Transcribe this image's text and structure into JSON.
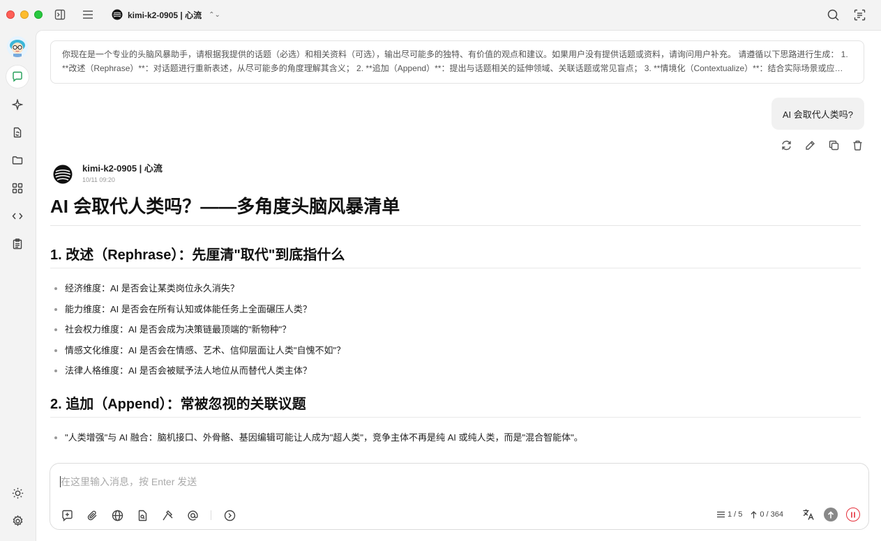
{
  "titlebar": {
    "model_label": "kimi-k2-0905 | 心流"
  },
  "system_prompt": {
    "text": "你现在是一个专业的头脑风暴助手，请根据我提供的话题（必选）和相关资料（可选），输出尽可能多的独特、有价值的观点和建议。如果用户没有提供话题或资料，请询问用户补充。 请遵循以下思路进行生成： 1. **改述（Rephrase）**：对话题进行重新表述，从尽可能多的角度理解其含义； 2. **追加（Append）**：提出与话题相关的延伸领域、关联话题或常见盲点； 3. **情境化（Contextualize）**：结合实际场景或应…"
  },
  "user_message": {
    "text": "AI 会取代人类吗?"
  },
  "assistant": {
    "name": "kimi-k2-0905 | 心流",
    "time": "10/11 09:20",
    "title": "AI 会取代人类吗？——多角度头脑风暴清单",
    "sections": [
      {
        "heading": "1. 改述（Rephrase）：先厘清\"取代\"到底指什么",
        "items": [
          "经济维度：AI 是否会让某类岗位永久消失？",
          "能力维度：AI 是否会在所有认知或体能任务上全面碾压人类？",
          "社会权力维度：AI 是否会成为决策链最顶端的\"新物种\"？",
          "情感文化维度：AI 是否会在情感、艺术、信仰层面让人类\"自愧不如\"？",
          "法律人格维度：AI 是否会被赋予法人地位从而替代人类主体？"
        ]
      },
      {
        "heading": "2. 追加（Append）：常被忽视的关联议题",
        "items": [
          "\"人类增强\"与 AI 融合：脑机接口、外骨骼、基因编辑可能让人成为\"超人类\"，竞争主体不再是纯 AI 或纯人类，而是\"混合智能体\"。"
        ]
      }
    ]
  },
  "input": {
    "placeholder": "在这里输入消息，按 Enter 发送",
    "context_count": "1 / 5",
    "token_count": "0 / 364"
  },
  "colors": {
    "accent": "#1f9d55",
    "stop": "#e5303b"
  }
}
